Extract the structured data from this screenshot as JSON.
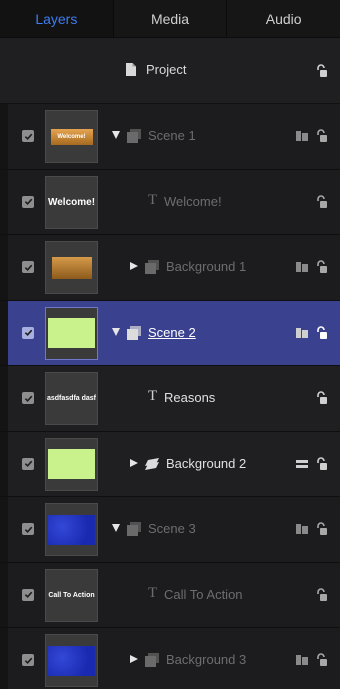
{
  "tabs": [
    {
      "label": "Layers",
      "active": true
    },
    {
      "label": "Media",
      "active": false
    },
    {
      "label": "Audio",
      "active": false
    }
  ],
  "project": {
    "label": "Project",
    "icon": "document-icon"
  },
  "layers": [
    {
      "name": "Scene 1",
      "kind": "group",
      "expanded": true,
      "indent": 0,
      "state": "grey",
      "thumb": {
        "style": "bronze-banner",
        "text": "Welcome!"
      },
      "checked": true
    },
    {
      "name": "Welcome!",
      "kind": "text",
      "indent": 1,
      "state": "grey",
      "thumb": {
        "style": "text",
        "text": "Welcome!"
      },
      "checked": true
    },
    {
      "name": "Background 1",
      "kind": "group",
      "expanded": false,
      "indent": 1,
      "state": "grey",
      "thumb": {
        "style": "bronze",
        "text": ""
      },
      "checked": true
    },
    {
      "name": "Scene 2",
      "kind": "group",
      "expanded": true,
      "indent": 0,
      "state": "selected",
      "thumb": {
        "style": "green",
        "text": ""
      },
      "checked": true
    },
    {
      "name": "Reasons",
      "kind": "text",
      "indent": 1,
      "state": "normal",
      "thumb": {
        "style": "text",
        "text": "asdfasdfa dasf"
      },
      "checked": true
    },
    {
      "name": "Background 2",
      "kind": "group-alt",
      "expanded": false,
      "indent": 1,
      "state": "normal",
      "thumb": {
        "style": "green",
        "text": ""
      },
      "checked": true
    },
    {
      "name": "Scene 3",
      "kind": "group",
      "expanded": true,
      "indent": 0,
      "state": "grey",
      "thumb": {
        "style": "blue",
        "text": ""
      },
      "checked": true
    },
    {
      "name": "Call To Action",
      "kind": "text",
      "indent": 1,
      "state": "grey",
      "thumb": {
        "style": "text",
        "text": "Call To Action"
      },
      "checked": true
    },
    {
      "name": "Background 3",
      "kind": "group",
      "expanded": false,
      "indent": 1,
      "state": "grey",
      "thumb": {
        "style": "blue",
        "text": ""
      },
      "checked": true
    }
  ],
  "colors": {
    "accent": "#3d7cf2",
    "selection": "#3a4290",
    "panel": "#1f1f21"
  }
}
